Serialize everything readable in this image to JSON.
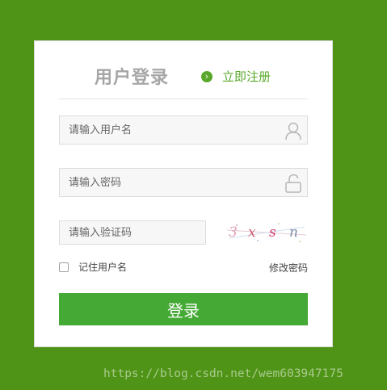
{
  "header": {
    "title": "用户登录",
    "register_icon": "chevron-right-icon",
    "register_label": "立即注册"
  },
  "form": {
    "username_placeholder": "请输入用户名",
    "password_placeholder": "请输入密码",
    "captcha_placeholder": "请输入验证码",
    "captcha_chars": [
      "3",
      "x",
      "s",
      "n"
    ],
    "remember_label": "记住用户名",
    "change_password_label": "修改密码",
    "login_label": "登录"
  },
  "watermark": "https://blog.csdn.net/wem603947175",
  "colors": {
    "background": "#4f9416",
    "accent": "#5aa82b",
    "button": "#45a935"
  }
}
